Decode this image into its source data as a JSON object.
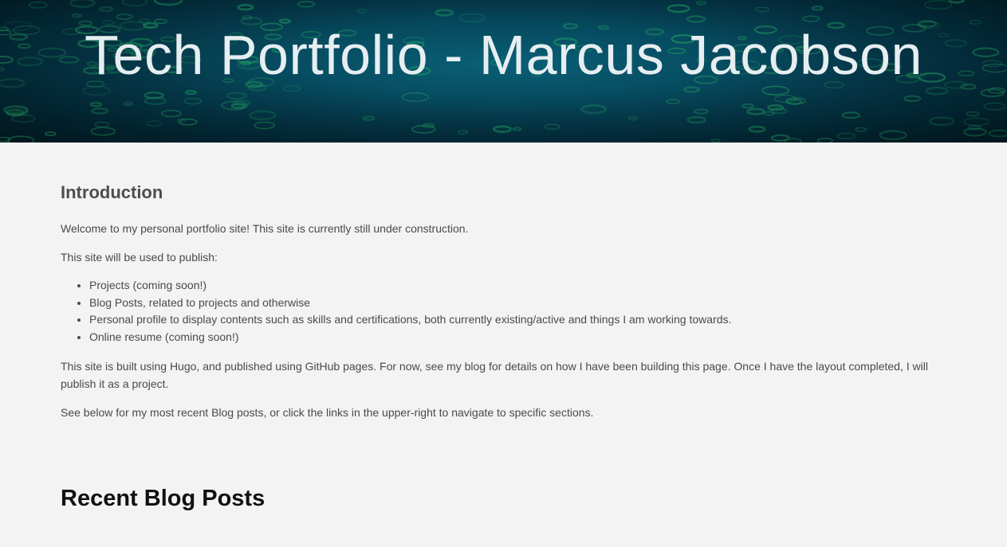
{
  "header": {
    "title": "Tech Portfolio - Marcus Jacobson"
  },
  "intro": {
    "heading": "Introduction",
    "welcome": "Welcome to my personal portfolio site! This site is currently still under construction.",
    "publish_lead": "This site will be used to publish:",
    "items": [
      "Projects (coming soon!)",
      "Blog Posts, related to projects and otherwise",
      "Personal profile to display contents such as skills and certifications, both currently existing/active and things I am working towards.",
      "Online resume (coming soon!)"
    ],
    "built_with": "This site is built using Hugo, and published using GitHub pages. For now, see my blog for details on how I have been building this page. Once I have the layout completed, I will publish it as a project.",
    "see_below": "See below for my most recent Blog posts, or click the links in the upper-right to navigate to specific sections."
  },
  "blog": {
    "heading": "Recent Blog Posts"
  },
  "colors": {
    "hero_accent": "#0a5f76",
    "hero_glyphs": "#1f9a63",
    "page_background": "#f3f3f3"
  }
}
